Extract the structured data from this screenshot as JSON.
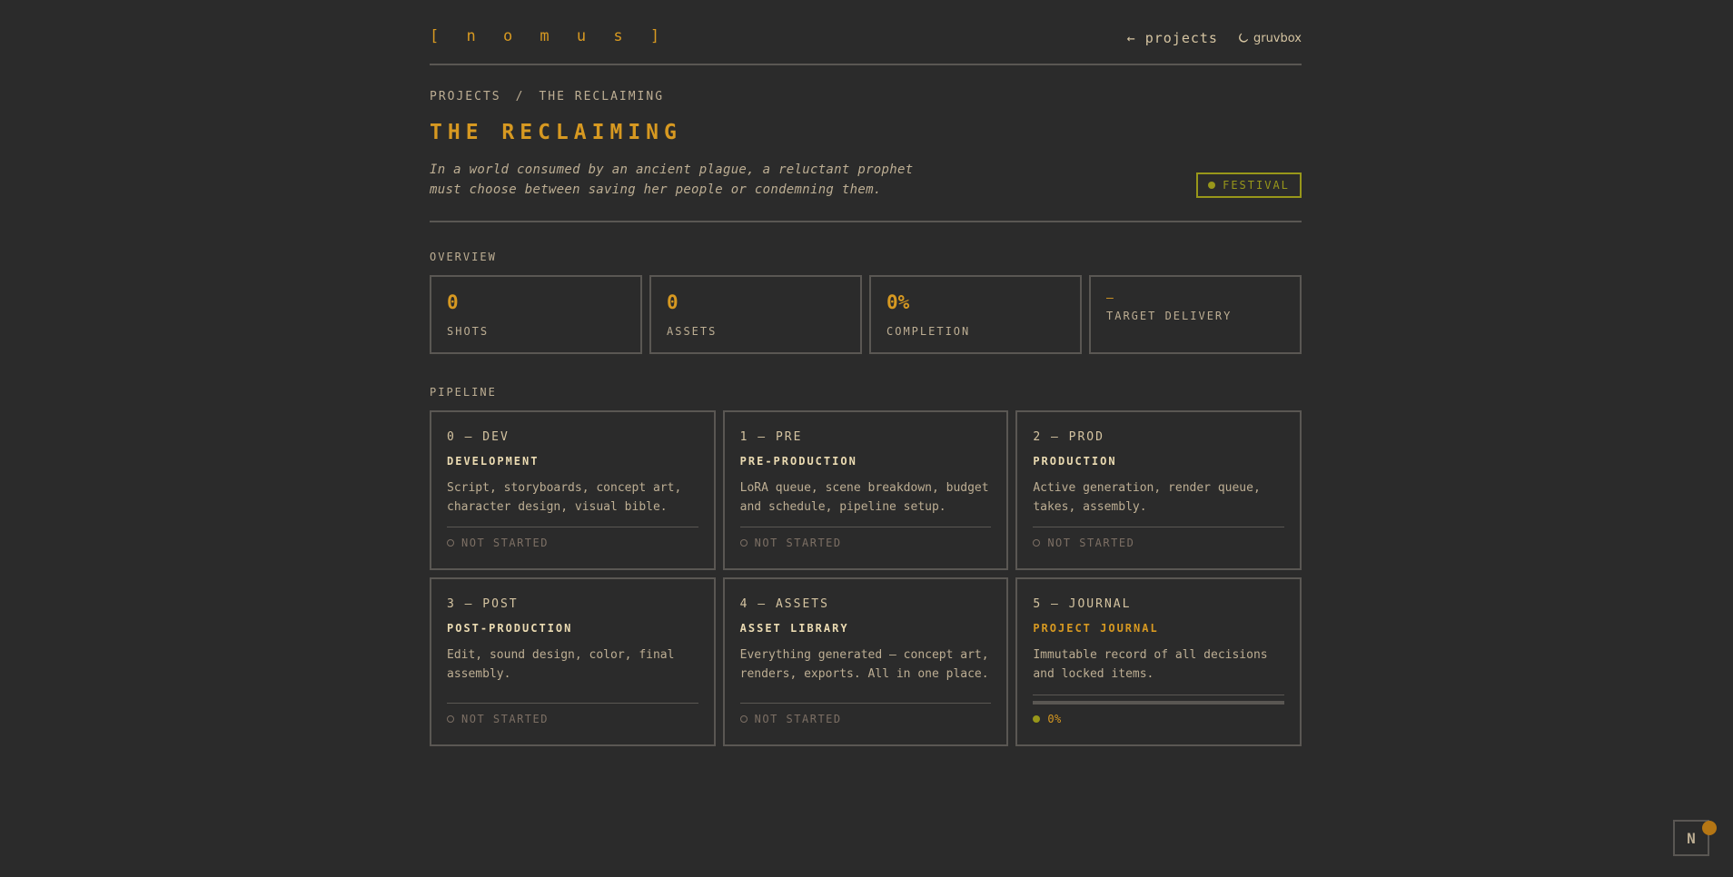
{
  "header": {
    "logo": "[ n o m u s ]",
    "back_link": "← projects",
    "theme_label": "gruvbox"
  },
  "breadcrumb": {
    "root": "PROJECTS",
    "separator": "/",
    "current": "THE RECLAIMING"
  },
  "project": {
    "title": "THE RECLAIMING",
    "logline_line1": "In a world consumed by an ancient plague, a reluctant prophet",
    "logline_line2": "must choose between saving her people or condemning them.",
    "badge": "FESTIVAL"
  },
  "overview": {
    "label": "OVERVIEW",
    "stats": [
      {
        "value": "0",
        "label": "SHOTS"
      },
      {
        "value": "0",
        "label": "ASSETS"
      },
      {
        "value": "0%",
        "label": "COMPLETION"
      },
      {
        "value": "—",
        "label": "TARGET DELIVERY"
      }
    ]
  },
  "pipeline": {
    "label": "PIPELINE",
    "cards": [
      {
        "code": "0 — DEV",
        "name": "DEVELOPMENT",
        "desc": "Script, storyboards, concept art, character design, visual bible.",
        "status": "NOT STARTED"
      },
      {
        "code": "1 — PRE",
        "name": "PRE-PRODUCTION",
        "desc": "LoRA queue, scene breakdown, budget and schedule, pipeline setup.",
        "status": "NOT STARTED"
      },
      {
        "code": "2 — PROD",
        "name": "PRODUCTION",
        "desc": "Active generation, render queue, takes, assembly.",
        "status": "NOT STARTED"
      },
      {
        "code": "3 — POST",
        "name": "POST-PRODUCTION",
        "desc": "Edit, sound design, color, final assembly.",
        "status": "NOT STARTED"
      },
      {
        "code": "4 — ASSETS",
        "name": "ASSET LIBRARY",
        "desc": "Everything generated — concept art, renders, exports. All in one place.",
        "status": "NOT STARTED"
      },
      {
        "code": "5 — JOURNAL",
        "name": "PROJECT JOURNAL",
        "desc": "Immutable record of all decisions and locked items.",
        "status": "0%",
        "progress": 0
      }
    ]
  },
  "corner_button": "N",
  "colors": {
    "background": "#2b2b2b",
    "accent": "#d79921",
    "green": "#98971a",
    "border": "#5a5753",
    "text": "#bdae93"
  }
}
